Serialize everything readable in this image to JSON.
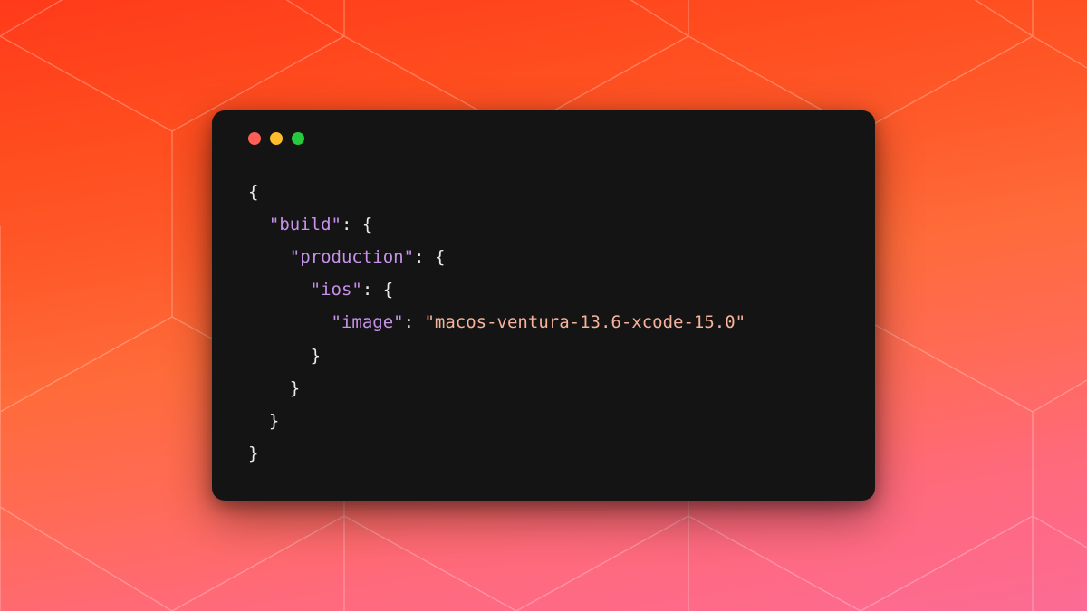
{
  "colors": {
    "bg_gradient_top": "#ff3a1a",
    "bg_gradient_bottom": "#fc6b94",
    "window_bg": "#141414",
    "traffic_close": "#ff5f56",
    "traffic_min": "#ffbd2e",
    "traffic_max": "#27c93f",
    "syntax_brace": "#e9e9e9",
    "syntax_key": "#c792ea",
    "syntax_string": "#f6b29a"
  },
  "code": {
    "indent": "  ",
    "lines": [
      {
        "t": "brace",
        "text": "{",
        "depth": 0
      },
      {
        "t": "key-open",
        "key": "build",
        "depth": 1
      },
      {
        "t": "key-open",
        "key": "production",
        "depth": 2
      },
      {
        "t": "key-open",
        "key": "ios",
        "depth": 3
      },
      {
        "t": "key-value",
        "key": "image",
        "value": "macos-ventura-13.6-xcode-15.0",
        "depth": 4
      },
      {
        "t": "brace",
        "text": "}",
        "depth": 3
      },
      {
        "t": "brace",
        "text": "}",
        "depth": 2
      },
      {
        "t": "brace",
        "text": "}",
        "depth": 1
      },
      {
        "t": "brace",
        "text": "}",
        "depth": 0
      }
    ]
  }
}
